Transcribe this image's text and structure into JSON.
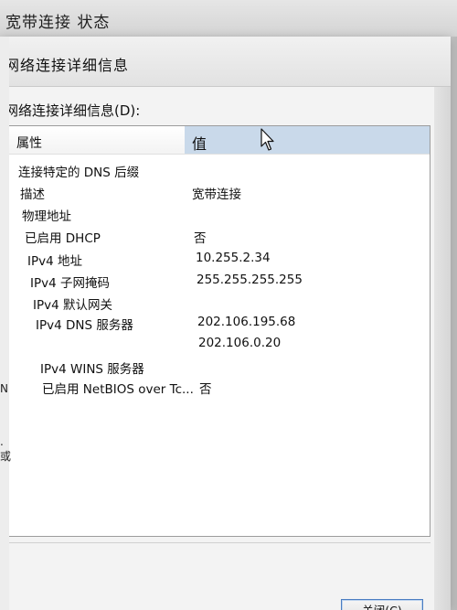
{
  "background_window": {
    "title": "宽带连接 状态",
    "fragments": [
      "N",
      ". 或"
    ]
  },
  "dialog": {
    "title": "网络连接详细信息",
    "section_label": "网络连接详细信息(D):",
    "columns": {
      "property": "属性",
      "value": "值"
    },
    "rows": [
      {
        "property": "连接特定的 DNS 后缀",
        "value": ""
      },
      {
        "property": "描述",
        "value": "宽带连接"
      },
      {
        "property": "物理地址",
        "value": ""
      },
      {
        "property": "已启用 DHCP",
        "value": "否"
      },
      {
        "property": "IPv4 地址",
        "value": "10.255.2.34"
      },
      {
        "property": "IPv4 子网掩码",
        "value": "255.255.255.255"
      },
      {
        "property": "IPv4 默认网关",
        "value": ""
      },
      {
        "property": "IPv4 DNS 服务器",
        "value": "202.106.195.68"
      },
      {
        "property": "",
        "value": "202.106.0.20"
      },
      {
        "property": "IPv4 WINS 服务器",
        "value": ""
      },
      {
        "property": "已启用 NetBIOS over Tc...",
        "value": "否"
      }
    ],
    "close_button": "关闭(C)"
  },
  "colors": {
    "header_highlight": "#c9d9ea",
    "button_border": "#4a7cc1"
  }
}
